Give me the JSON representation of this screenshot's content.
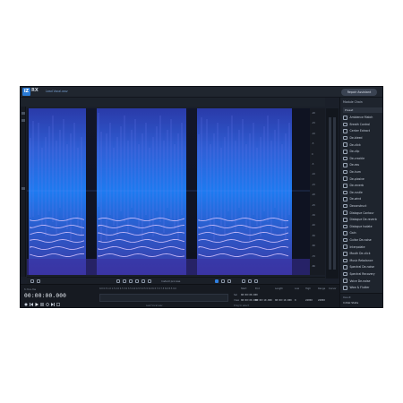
{
  "app": {
    "logo": "iZ",
    "product": "RX",
    "file_tab": "Lead Vocal.wav",
    "repair_assistant_label": "Repair Assistant"
  },
  "module_panel": {
    "title": "Module Chain",
    "preset": "Preset",
    "modules": [
      {
        "label": "Ambience Match",
        "icon": "ambience-match-icon"
      },
      {
        "label": "Breath Control",
        "icon": "breath-control-icon"
      },
      {
        "label": "Center Extract",
        "icon": "center-extract-icon"
      },
      {
        "label": "De-bleed",
        "icon": "de-bleed-icon"
      },
      {
        "label": "De-click",
        "icon": "de-click-icon"
      },
      {
        "label": "De-clip",
        "icon": "de-clip-icon"
      },
      {
        "label": "De-crackle",
        "icon": "de-crackle-icon"
      },
      {
        "label": "De-ess",
        "icon": "de-ess-icon"
      },
      {
        "label": "De-hum",
        "icon": "de-hum-icon"
      },
      {
        "label": "De-plosive",
        "icon": "de-plosive-icon"
      },
      {
        "label": "De-reverb",
        "icon": "de-reverb-icon"
      },
      {
        "label": "De-rustle",
        "icon": "de-rustle-icon"
      },
      {
        "label": "De-wind",
        "icon": "de-wind-icon"
      },
      {
        "label": "Deconstruct",
        "icon": "deconstruct-icon"
      },
      {
        "label": "Dialogue Contour",
        "icon": "dialogue-contour-icon"
      },
      {
        "label": "Dialogue De-reverb",
        "icon": "dialogue-de-reverb-icon"
      },
      {
        "label": "Dialogue Isolate",
        "icon": "dialogue-isolate-icon"
      },
      {
        "label": "Gain",
        "icon": "gain-icon"
      },
      {
        "label": "Guitar De-noise",
        "icon": "guitar-de-noise-icon"
      },
      {
        "label": "Interpolate",
        "icon": "interpolate-icon"
      },
      {
        "label": "Mouth De-click",
        "icon": "mouth-de-click-icon"
      },
      {
        "label": "Music Rebalance",
        "icon": "music-rebalance-icon"
      },
      {
        "label": "Spectral De-noise",
        "icon": "spectral-de-noise-icon"
      },
      {
        "label": "Spectral Recovery",
        "icon": "spectral-recovery-icon"
      },
      {
        "label": "Voice De-noise",
        "icon": "voice-de-noise-icon"
      },
      {
        "label": "Wow & Flutter",
        "icon": "wow-flutter-icon"
      }
    ],
    "footer_heading": "Result",
    "footer_value": "Initial State"
  },
  "ruler": {
    "labels": [
      "-20",
      "-15",
      "-10",
      "-5",
      "0",
      "-5",
      "-10",
      "-15",
      "-20",
      "-25",
      "-30",
      "-40",
      "-50",
      "-60",
      "-70",
      "-80"
    ]
  },
  "toolbar": {
    "zoom_label": "Instant process",
    "gain_label": "Gain"
  },
  "transport": {
    "time_label": "h:m:s.ms",
    "timecode": "00:00:00.000",
    "timeline_ticks": "0.0  0.5  1.0  1.5  2.0  2.5  3.0  3.5  4.0  4.5  5.0  5.5  6.0  6.5  7.0  7.5  8.0  8.5  9.0",
    "track_caption": "Lead Vocal.wav"
  },
  "selection_table": {
    "headers": [
      "Start",
      "End",
      "Length",
      "Low",
      "High",
      "Range",
      "Cursor"
    ],
    "sel_label": "Sel",
    "view_label": "View",
    "sel_values": [
      "00:00:00.000",
      "",
      "",
      "",
      "",
      "",
      ""
    ],
    "view_values": [
      "00:00:00.000",
      "00:00:10.000",
      "00:00:10.000",
      "0",
      "22050",
      "22050",
      ""
    ],
    "hint": "Drag to select"
  }
}
